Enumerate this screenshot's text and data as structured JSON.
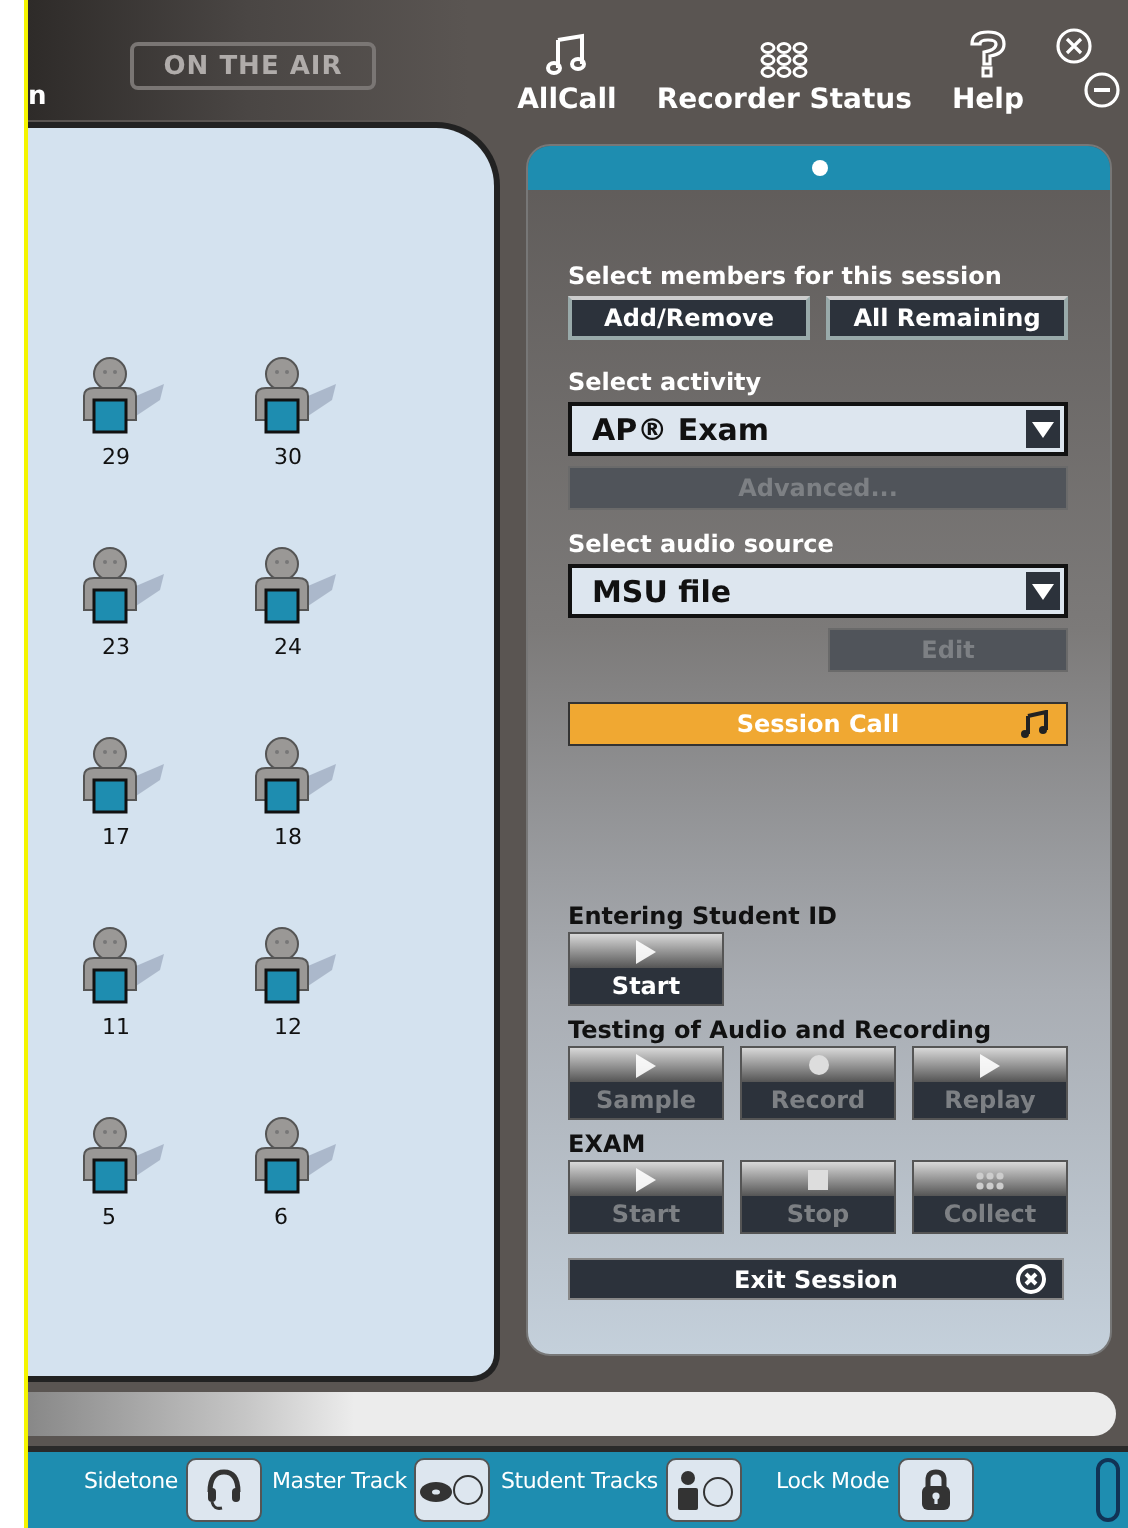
{
  "toolbar": {
    "cut_label": "n",
    "status_badge": "ON THE AIR",
    "actions": [
      {
        "label": "AllCall",
        "kind": "allcall"
      },
      {
        "label": "Recorder Status",
        "kind": "recorder"
      },
      {
        "label": "Help",
        "kind": "help"
      }
    ]
  },
  "seats": [
    {
      "number": "29"
    },
    {
      "number": "30"
    },
    {
      "number": "23"
    },
    {
      "number": "24"
    },
    {
      "number": "17"
    },
    {
      "number": "18"
    },
    {
      "number": "11"
    },
    {
      "number": "12"
    },
    {
      "number": "5"
    },
    {
      "number": "6"
    }
  ],
  "session_panel": {
    "members": {
      "label": "Select members for this session",
      "buttons": [
        {
          "label": "Add/Remove"
        },
        {
          "label": "All Remaining"
        }
      ]
    },
    "activity": {
      "label": "Select activity",
      "value": "AP® Exam",
      "advanced": {
        "label": "Advanced...",
        "disabled": true
      }
    },
    "audio": {
      "label": "Select audio source",
      "value": "MSU file",
      "edit": {
        "label": "Edit",
        "disabled": true
      }
    },
    "session_call": "Session Call",
    "groups": [
      {
        "title": "Entering Student ID",
        "buttons": [
          {
            "label": "Start",
            "kind": "play",
            "disabled": false
          }
        ]
      },
      {
        "title": "Testing of Audio and Recording",
        "buttons": [
          {
            "label": "Sample",
            "kind": "play",
            "disabled": true
          },
          {
            "label": "Record",
            "kind": "record",
            "disabled": true
          },
          {
            "label": "Replay",
            "kind": "play",
            "disabled": true
          }
        ]
      },
      {
        "title": "EXAM",
        "buttons": [
          {
            "label": "Start",
            "kind": "play",
            "disabled": true
          },
          {
            "label": "Stop",
            "kind": "stop",
            "disabled": true
          },
          {
            "label": "Collect",
            "kind": "collect",
            "disabled": true
          }
        ]
      }
    ],
    "exit": "Exit Session"
  },
  "footer": [
    {
      "label": "Sidetone",
      "kind": "headset"
    },
    {
      "label": "Master Track",
      "kind": "disc"
    },
    {
      "label": "Student Tracks",
      "kind": "student"
    },
    {
      "label": "Lock Mode",
      "kind": "lock"
    }
  ]
}
